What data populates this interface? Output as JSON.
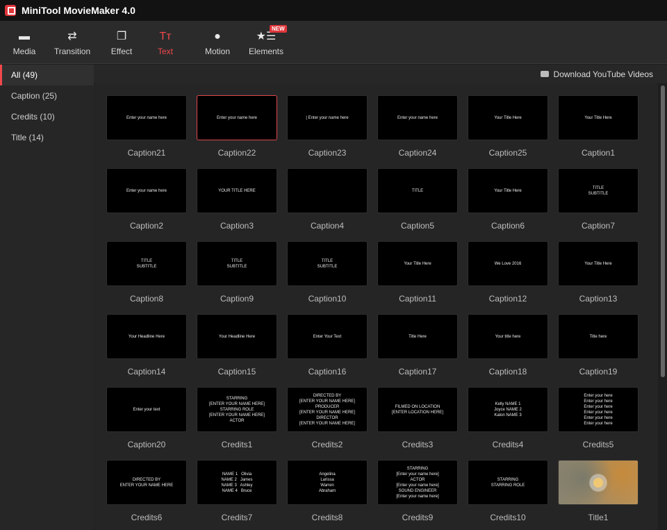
{
  "app": {
    "title": "MiniTool MovieMaker 4.0"
  },
  "toolbar": {
    "items": [
      {
        "label": "Media",
        "icon": "folder-icon",
        "glyph": "▬"
      },
      {
        "label": "Transition",
        "icon": "swap-arrows-icon",
        "glyph": "⇄"
      },
      {
        "label": "Effect",
        "icon": "layers-icon",
        "glyph": "❐"
      },
      {
        "label": "Text",
        "icon": "text-icon",
        "glyph": "Tт"
      },
      {
        "label": "Motion",
        "icon": "motion-icon",
        "glyph": "●"
      },
      {
        "label": "Elements",
        "icon": "elements-icon",
        "glyph": "★☰"
      }
    ],
    "active": "Text",
    "new_badge": "NEW"
  },
  "sidebar": {
    "items": [
      {
        "label": "All (49)"
      },
      {
        "label": "Caption (25)"
      },
      {
        "label": "Credits (10)"
      },
      {
        "label": "Title (14)"
      }
    ],
    "active": 0
  },
  "download": {
    "label": "Download YouTube Videos",
    "icon": "youtube-icon"
  },
  "accent": "#f0484b",
  "items": [
    {
      "name": "Caption21",
      "preview": "Enter your name here"
    },
    {
      "name": "Caption22",
      "preview": "Enter your name here",
      "selected": true
    },
    {
      "name": "Caption23",
      "preview": "| Enter your name here"
    },
    {
      "name": "Caption24",
      "preview": "Enter your name here"
    },
    {
      "name": "Caption25",
      "preview": "Your Title Here"
    },
    {
      "name": "Caption1",
      "preview": "Your Title Here"
    },
    {
      "name": "Caption2",
      "preview": "Enter your name here"
    },
    {
      "name": "Caption3",
      "preview": "YOUR TITLE HERE"
    },
    {
      "name": "Caption4",
      "preview": ""
    },
    {
      "name": "Caption5",
      "preview": "TITLE"
    },
    {
      "name": "Caption6",
      "preview": "Your Title Here"
    },
    {
      "name": "Caption7",
      "preview": "TITLE\nSUBTITLE"
    },
    {
      "name": "Caption8",
      "preview": "TITLE\nSUBTITLE"
    },
    {
      "name": "Caption9",
      "preview": "TITLE\nSUBTITLE"
    },
    {
      "name": "Caption10",
      "preview": "TITLE\nSUBTITLE"
    },
    {
      "name": "Caption11",
      "preview": "Your Title Here"
    },
    {
      "name": "Caption12",
      "preview": "We Love 2016"
    },
    {
      "name": "Caption13",
      "preview": "Your Title Here"
    },
    {
      "name": "Caption14",
      "preview": "Your Headline Here"
    },
    {
      "name": "Caption15",
      "preview": "Your Headline Here"
    },
    {
      "name": "Caption16",
      "preview": "Enter Your Text"
    },
    {
      "name": "Caption17",
      "preview": "Title Here"
    },
    {
      "name": "Caption18",
      "preview": "Your title here"
    },
    {
      "name": "Caption19",
      "preview": "Title here"
    },
    {
      "name": "Caption20",
      "preview": "Enter your text"
    },
    {
      "name": "Credits1",
      "preview": "STARRING\n[ENTER YOUR NAME HERE]\nSTARRING ROLE\n[ENTER YOUR NAME HERE]\nACTOR"
    },
    {
      "name": "Credits2",
      "preview": "DIRECTED BY\n[ENTER YOUR NAME HERE]\nPRODUCER\n[ENTER YOUR NAME HERE]\nDIRECTOR\n[ENTER YOUR NAME HERE]"
    },
    {
      "name": "Credits3",
      "preview": "FILMED ON LOCATION\n[ENTER LOCATION HERE]"
    },
    {
      "name": "Credits4",
      "preview": "Kelly NAME 1\nJoyce NAME 2\nKalon NAME 3"
    },
    {
      "name": "Credits5",
      "preview": "Enter your here\nEnter your here\nEnter your here\nEnter your here\nEnter your here\nEnter your here"
    },
    {
      "name": "Credits6",
      "preview": "DIRECTED BY\nENTER YOUR NAME HERE"
    },
    {
      "name": "Credits7",
      "preview": "NAME 1   Olivia\nNAME 2   James\nNAME 3   Ashley\nNAME 4   Bruce"
    },
    {
      "name": "Credits8",
      "preview": "Angelina\nLarissa\nWarren\nAbraham"
    },
    {
      "name": "Credits9",
      "preview": "STARRING\n[Enter your name here]\nACTOR\n[Enter your name here]\nSOUND ENGINEER\n[Enter your name here]"
    },
    {
      "name": "Credits10",
      "preview": "STARRING\nSTARRING ROLE"
    },
    {
      "name": "Title1",
      "preview": ""
    }
  ]
}
